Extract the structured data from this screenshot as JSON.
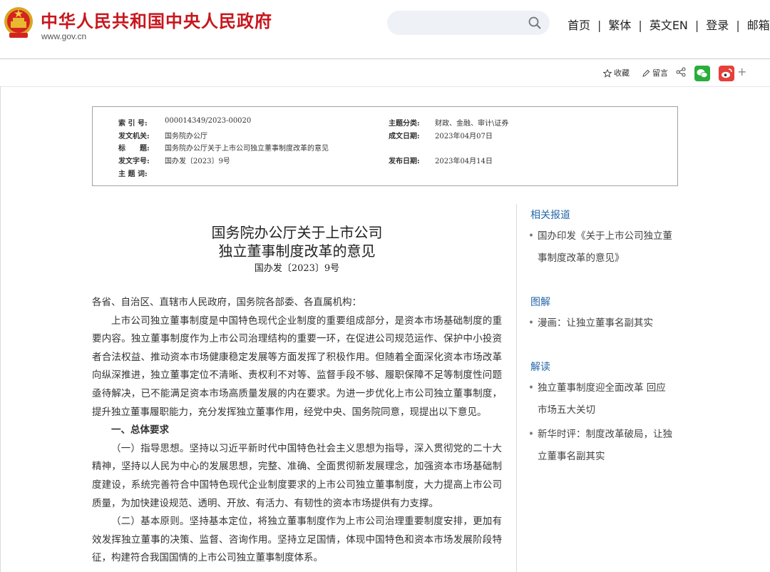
{
  "header": {
    "site_name": "中华人民共和国中央人民政府",
    "site_url": "www.gov.cn",
    "search": {
      "value": "",
      "placeholder": ""
    },
    "nav": [
      "首页",
      "繁体",
      "英文EN",
      "登录",
      "邮箱"
    ]
  },
  "toolbar": {
    "favorite_label": "收藏",
    "comment_label": "留言",
    "more_label": "+"
  },
  "meta": {
    "index_label": "索 引 号:",
    "index_value": "000014349/2023-00020",
    "topic_label": "主题分类:",
    "topic_value": "财政、金融、审计\\证券",
    "issuer_label": "发文机关:",
    "issuer_value": "国务院办公厅",
    "written_label": "成文日期:",
    "written_value": "2023年04月07日",
    "title_label": "标　　题:",
    "title_value": "国务院办公厅关于上市公司独立董事制度改革的意见",
    "docno_label": "发文字号:",
    "docno_value": "国办发〔2023〕9号",
    "publish_label": "发布日期:",
    "publish_value": "2023年04月14日",
    "keywords_label": "主 题 词:",
    "keywords_value": ""
  },
  "article": {
    "title_line1": "国务院办公厅关于上市公司",
    "title_line2": "独立董事制度改革的意见",
    "doc_number": "国办发〔2023〕9号",
    "salutation": "各省、自治区、直辖市人民政府，国务院各部委、各直属机构：",
    "para1": "上市公司独立董事制度是中国特色现代企业制度的重要组成部分，是资本市场基础制度的重要内容。独立董事制度作为上市公司治理结构的重要一环，在促进公司规范运作、保护中小投资者合法权益、推动资本市场健康稳定发展等方面发挥了积极作用。但随着全面深化资本市场改革向纵深推进，独立董事定位不清晰、责权利不对等、监督手段不够、履职保障不足等制度性问题亟待解决，已不能满足资本市场高质量发展的内在要求。为进一步优化上市公司独立董事制度，提升独立董事履职能力，充分发挥独立董事作用，经党中央、国务院同意，现提出以下意见。",
    "section1": "一、总体要求",
    "para2": "（一）指导思想。坚持以习近平新时代中国特色社会主义思想为指导，深入贯彻党的二十大精神，坚持以人民为中心的发展思想，完整、准确、全面贯彻新发展理念，加强资本市场基础制度建设，系统完善符合中国特色现代企业制度要求的上市公司独立董事制度，大力提高上市公司质量，为加快建设规范、透明、开放、有活力、有韧性的资本市场提供有力支撑。",
    "para3": "（二）基本原则。坚持基本定位，将独立董事制度作为上市公司治理重要制度安排，更加有效发挥独立董事的决策、监督、咨询作用。坚持立足国情，体现中国特色和资本市场发展阶段特征，构建符合我国国情的上市公司独立董事制度体系。"
  },
  "sidebar": {
    "related_title": "相关报道",
    "related_items": [
      "国办印发《关于上市公司独立董事制度改革的意见》"
    ],
    "graphic_title": "图解",
    "graphic_items": [
      "漫画：让独立董事名副其实"
    ],
    "interpret_title": "解读",
    "interpret_items": [
      "独立董事制度迎全面改革 回应市场五大关切",
      "新华时评：制度改革破局，让独立董事名副其实"
    ]
  },
  "colors": {
    "brand_red": "#c8161e",
    "link_blue": "#2567a8",
    "wechat_green": "#2aae3b",
    "weibo_red": "#e6403a"
  }
}
